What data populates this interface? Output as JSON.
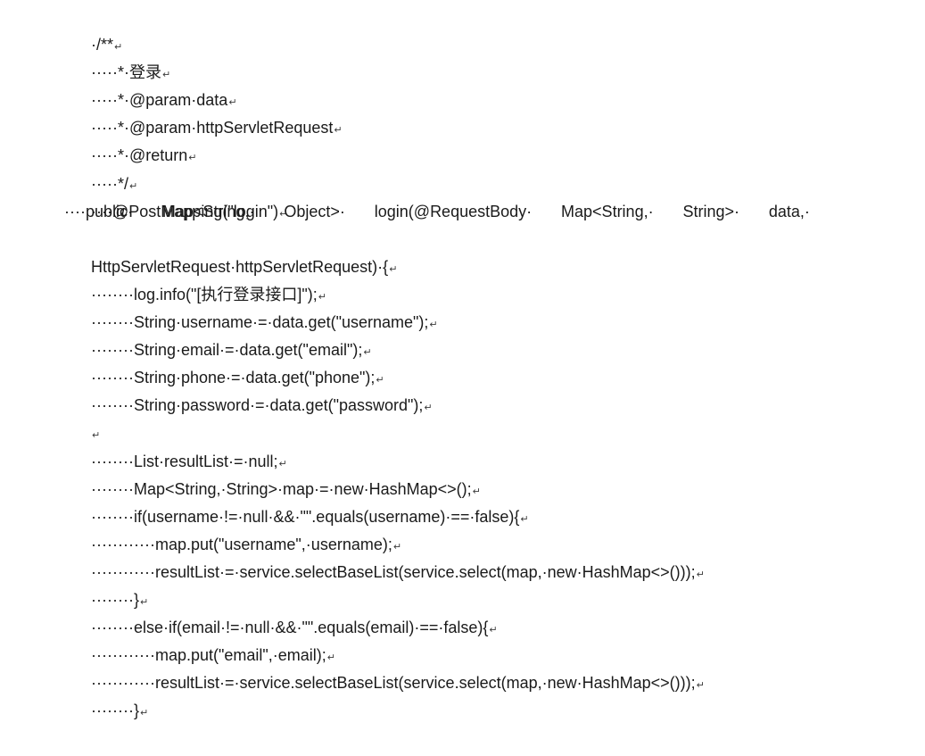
{
  "document": {
    "lines": [
      {
        "indent": "·",
        "text": "/**"
      },
      {
        "indent": "·····",
        "text": "*·登录"
      },
      {
        "indent": "·····",
        "text": "*·@param·data"
      },
      {
        "indent": "·····",
        "text": "*·@param·httpServletRequest"
      },
      {
        "indent": "·····",
        "text": "*·@return"
      },
      {
        "indent": "·····",
        "text": "*/"
      },
      {
        "indent": "····",
        "text": "@PostMapping(\"login\")"
      },
      {
        "indent": "····",
        "text": "public·Map<String,·Object>·login(@RequestBody·Map<String,·String>·data,·",
        "justify": true,
        "parts": [
          "····public·",
          "Map<String,·",
          "Object>·",
          "login(@RequestBody·",
          "Map<String,·",
          "String>·",
          "data,·"
        ]
      },
      {
        "indent": "",
        "text": "HttpServletRequest·httpServletRequest)·{"
      },
      {
        "indent": "········",
        "text": "log.info(\"[执行登录接口]\");"
      },
      {
        "indent": "········",
        "text": "String·username·=·data.get(\"username\");"
      },
      {
        "indent": "········",
        "text": "String·email·=·data.get(\"email\");"
      },
      {
        "indent": "········",
        "text": "String·phone·=·data.get(\"phone\");"
      },
      {
        "indent": "········",
        "text": "String·password·=·data.get(\"password\");"
      },
      {
        "indent": "",
        "text": ""
      },
      {
        "indent": "········",
        "text": "List·resultList·=·null;"
      },
      {
        "indent": "········",
        "text": "Map<String,·String>·map·=·new·HashMap<>();"
      },
      {
        "indent": "········",
        "text": "if(username·!=·null·&&·\"\".equals(username)·==·false){"
      },
      {
        "indent": "············",
        "text": "map.put(\"username\",·username);"
      },
      {
        "indent": "············",
        "text": "resultList·=·service.selectBaseList(service.select(map,·new·HashMap<>()));"
      },
      {
        "indent": "········",
        "text": "}"
      },
      {
        "indent": "········",
        "text": "else·if(email·!=·null·&&·\"\".equals(email)·==·false){"
      },
      {
        "indent": "············",
        "text": "map.put(\"email\",·email);"
      },
      {
        "indent": "············",
        "text": "resultList·=·service.selectBaseList(service.select(map,·new·HashMap<>()));"
      },
      {
        "indent": "········",
        "text": "}"
      }
    ],
    "paragraph_mark": "↵"
  }
}
